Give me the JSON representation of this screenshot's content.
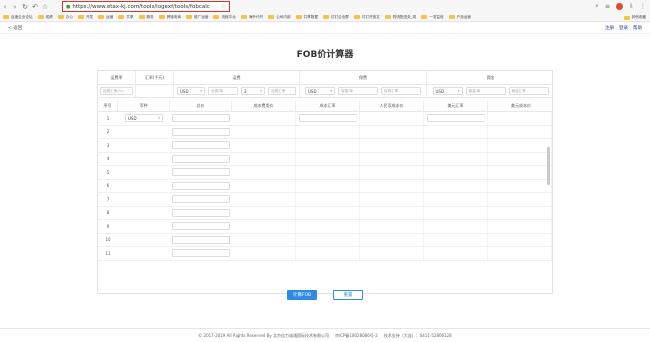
{
  "browser": {
    "url": "https://www.etax-kj.com/tools/logexf/tools/fobcalc",
    "bookmarks": [
      "百度企业论坛",
      "成绩",
      "办公",
      "开发",
      "运营",
      "共享",
      "服务",
      "跨境电商",
      "推广运营",
      "流程平台",
      "海外代开",
      "公司内部",
      "共享数据",
      "钉钉企业群",
      "钉钉开放文",
      "物流配送处_现",
      "一览益信",
      "产品运营"
    ],
    "bookmarks_right": "其他收藏"
  },
  "site": {
    "back": "< 返回",
    "links": [
      "注册",
      "登录",
      "帮助"
    ]
  },
  "title": "FOB价计算器",
  "header_groups": {
    "freight_rate": "运费率",
    "exchange_rate": "汇率(千元)",
    "freight": "运费",
    "insurance": "保费",
    "commission": "佣金"
  },
  "inputs": {
    "freight_rate_ph": "运费汇率(%)",
    "freight_currency": "USD",
    "freight_amount_ph": "运费/单",
    "freight_qty": "3",
    "freight_rate_ph2": "运费汇率",
    "ins_currency": "USD",
    "ins_amount_ph": "保费/单",
    "ins_rate_ph": "保费汇率",
    "comm_currency": "USD",
    "comm_amount_ph": "佣金/单",
    "comm_rate_ph": "佣金汇率"
  },
  "columns": [
    "序号",
    "币种",
    "总价",
    "成本费用价",
    "成本汇率",
    "人民币成本价",
    "美元汇率",
    "美元成本价"
  ],
  "rows": [
    {
      "num": "1",
      "currency": "USD"
    },
    {
      "num": "2"
    },
    {
      "num": "3"
    },
    {
      "num": "4"
    },
    {
      "num": "5"
    },
    {
      "num": "6"
    },
    {
      "num": "7"
    },
    {
      "num": "8"
    },
    {
      "num": "9"
    },
    {
      "num": "10"
    },
    {
      "num": "11"
    }
  ],
  "buttons": {
    "calculate": "计算FOB",
    "reset": "重置"
  },
  "footer": {
    "copyright": "© 2017-2019 All Rights Reserved By 北京佳力诚通国际技术有限公司",
    "icp": "京ICP备18028086号-2",
    "support": "技术支持（大连）：0411-52806128"
  }
}
